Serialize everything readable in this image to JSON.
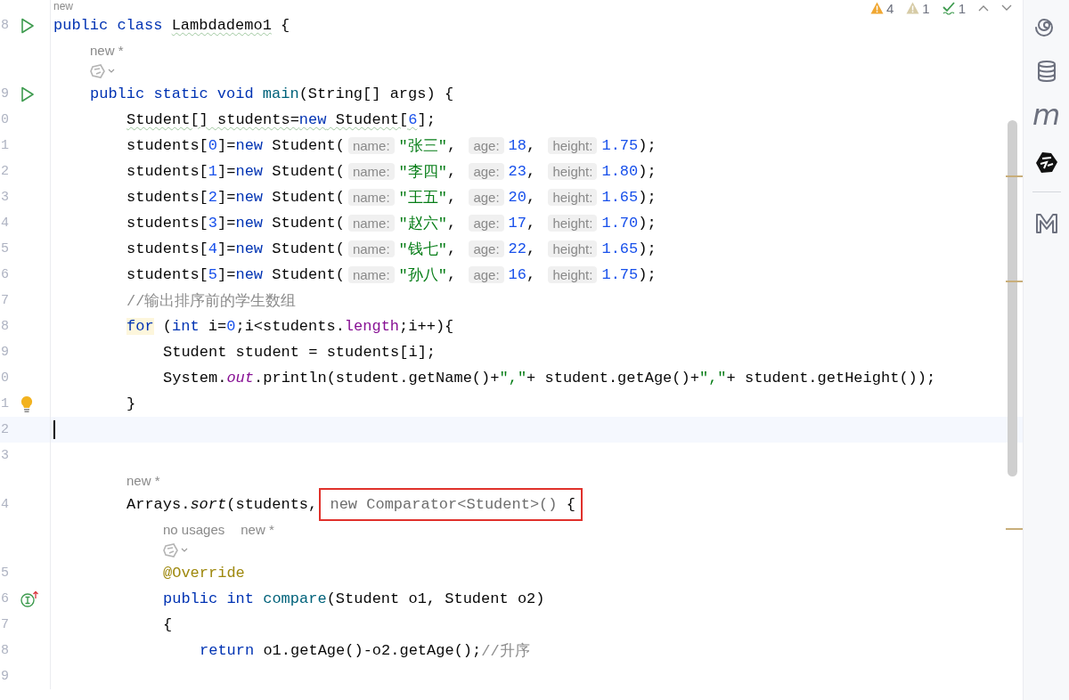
{
  "inspections": [
    {
      "kind": "warning",
      "count": "4"
    },
    {
      "kind": "weak_warning",
      "count": "1"
    },
    {
      "kind": "typo",
      "count": "1"
    }
  ],
  "lines": [
    {
      "kind": "lens",
      "texts": [
        "new"
      ]
    },
    {
      "kind": "code",
      "number": "8",
      "gutter_icon": {
        "kind": "run"
      },
      "tokens": [
        {
          "kind": "kw",
          "text": "public class "
        },
        {
          "kind": "plain",
          "text": "Lambdademo1",
          "typo": true
        },
        {
          "kind": "plain",
          "text": " {"
        }
      ],
      "children": [
        {
          "kind": "lens",
          "texts": [
            "new *"
          ]
        },
        {
          "kind": "ai"
        },
        {
          "kind": "code",
          "number": "9",
          "gutter_icon": {
            "kind": "run"
          },
          "tokens": [
            {
              "kind": "kw",
              "text": "public static void "
            },
            {
              "kind": "method",
              "text": "main"
            },
            {
              "kind": "plain",
              "text": "(String[] args) {"
            }
          ],
          "children": [
            {
              "kind": "code",
              "number": "0",
              "tokens": [
                {
                  "kind": "plain",
                  "text": "Student[] students=",
                  "typo": true
                },
                {
                  "kind": "kw",
                  "text": "new",
                  "typo": true
                },
                {
                  "kind": "plain",
                  "text": " Student[",
                  "typo": true
                },
                {
                  "kind": "num",
                  "text": "6",
                  "typo": true
                },
                {
                  "kind": "plain",
                  "text": "];"
                }
              ]
            },
            {
              "kind": "code",
              "number": "1",
              "tokens": [
                {
                  "kind": "plain",
                  "text": "students["
                },
                {
                  "kind": "num",
                  "text": "0"
                },
                {
                  "kind": "plain",
                  "text": "]="
                },
                {
                  "kind": "kw",
                  "text": "new"
                },
                {
                  "kind": "plain",
                  "text": " Student("
                },
                {
                  "kind": "hint",
                  "text": "name:"
                },
                {
                  "kind": "str",
                  "text": "\"张三\""
                },
                {
                  "kind": "plain",
                  "text": ", "
                },
                {
                  "kind": "hint",
                  "text": "age:"
                },
                {
                  "kind": "num",
                  "text": "18"
                },
                {
                  "kind": "plain",
                  "text": ", "
                },
                {
                  "kind": "hint",
                  "text": "height:"
                },
                {
                  "kind": "num",
                  "text": "1.75"
                },
                {
                  "kind": "plain",
                  "text": ");"
                }
              ]
            },
            {
              "kind": "code",
              "number": "2",
              "tokens": [
                {
                  "kind": "plain",
                  "text": "students["
                },
                {
                  "kind": "num",
                  "text": "1"
                },
                {
                  "kind": "plain",
                  "text": "]="
                },
                {
                  "kind": "kw",
                  "text": "new"
                },
                {
                  "kind": "plain",
                  "text": " Student("
                },
                {
                  "kind": "hint",
                  "text": "name:"
                },
                {
                  "kind": "str",
                  "text": "\"李四\""
                },
                {
                  "kind": "plain",
                  "text": ", "
                },
                {
                  "kind": "hint",
                  "text": "age:"
                },
                {
                  "kind": "num",
                  "text": "23"
                },
                {
                  "kind": "plain",
                  "text": ", "
                },
                {
                  "kind": "hint",
                  "text": "height:"
                },
                {
                  "kind": "num",
                  "text": "1.80"
                },
                {
                  "kind": "plain",
                  "text": ");"
                }
              ]
            },
            {
              "kind": "code",
              "number": "3",
              "tokens": [
                {
                  "kind": "plain",
                  "text": "students["
                },
                {
                  "kind": "num",
                  "text": "2"
                },
                {
                  "kind": "plain",
                  "text": "]="
                },
                {
                  "kind": "kw",
                  "text": "new"
                },
                {
                  "kind": "plain",
                  "text": " Student("
                },
                {
                  "kind": "hint",
                  "text": "name:"
                },
                {
                  "kind": "str",
                  "text": "\"王五\""
                },
                {
                  "kind": "plain",
                  "text": ", "
                },
                {
                  "kind": "hint",
                  "text": "age:"
                },
                {
                  "kind": "num",
                  "text": "20"
                },
                {
                  "kind": "plain",
                  "text": ", "
                },
                {
                  "kind": "hint",
                  "text": "height:"
                },
                {
                  "kind": "num",
                  "text": "1.65"
                },
                {
                  "kind": "plain",
                  "text": ");"
                }
              ]
            },
            {
              "kind": "code",
              "number": "4",
              "tokens": [
                {
                  "kind": "plain",
                  "text": "students["
                },
                {
                  "kind": "num",
                  "text": "3"
                },
                {
                  "kind": "plain",
                  "text": "]="
                },
                {
                  "kind": "kw",
                  "text": "new"
                },
                {
                  "kind": "plain",
                  "text": " Student("
                },
                {
                  "kind": "hint",
                  "text": "name:"
                },
                {
                  "kind": "str",
                  "text": "\"赵六\""
                },
                {
                  "kind": "plain",
                  "text": ", "
                },
                {
                  "kind": "hint",
                  "text": "age:"
                },
                {
                  "kind": "num",
                  "text": "17"
                },
                {
                  "kind": "plain",
                  "text": ", "
                },
                {
                  "kind": "hint",
                  "text": "height:"
                },
                {
                  "kind": "num",
                  "text": "1.70"
                },
                {
                  "kind": "plain",
                  "text": ");"
                }
              ]
            },
            {
              "kind": "code",
              "number": "5",
              "tokens": [
                {
                  "kind": "plain",
                  "text": "students["
                },
                {
                  "kind": "num",
                  "text": "4"
                },
                {
                  "kind": "plain",
                  "text": "]="
                },
                {
                  "kind": "kw",
                  "text": "new"
                },
                {
                  "kind": "plain",
                  "text": " Student("
                },
                {
                  "kind": "hint",
                  "text": "name:"
                },
                {
                  "kind": "str",
                  "text": "\"钱七\""
                },
                {
                  "kind": "plain",
                  "text": ", "
                },
                {
                  "kind": "hint",
                  "text": "age:"
                },
                {
                  "kind": "num",
                  "text": "22"
                },
                {
                  "kind": "plain",
                  "text": ", "
                },
                {
                  "kind": "hint",
                  "text": "height:"
                },
                {
                  "kind": "num",
                  "text": "1.65"
                },
                {
                  "kind": "plain",
                  "text": ");"
                }
              ]
            },
            {
              "kind": "code",
              "number": "6",
              "tokens": [
                {
                  "kind": "plain",
                  "text": "students["
                },
                {
                  "kind": "num",
                  "text": "5"
                },
                {
                  "kind": "plain",
                  "text": "]="
                },
                {
                  "kind": "kw",
                  "text": "new"
                },
                {
                  "kind": "plain",
                  "text": " Student("
                },
                {
                  "kind": "hint",
                  "text": "name:"
                },
                {
                  "kind": "str",
                  "text": "\"孙八\""
                },
                {
                  "kind": "plain",
                  "text": ", "
                },
                {
                  "kind": "hint",
                  "text": "age:"
                },
                {
                  "kind": "num",
                  "text": "16"
                },
                {
                  "kind": "plain",
                  "text": ", "
                },
                {
                  "kind": "hint",
                  "text": "height:"
                },
                {
                  "kind": "num",
                  "text": "1.75"
                },
                {
                  "kind": "plain",
                  "text": ");"
                }
              ]
            },
            {
              "kind": "code",
              "number": "7",
              "tokens": [
                {
                  "kind": "comment",
                  "text": "//输出排序前的学生数组"
                }
              ]
            },
            {
              "kind": "code",
              "number": "8",
              "tokens": [
                {
                  "kind": "kw",
                  "text": "for",
                  "highlighted": true
                },
                {
                  "kind": "plain",
                  "text": " ("
                },
                {
                  "kind": "kw",
                  "text": "int"
                },
                {
                  "kind": "plain",
                  "text": " i="
                },
                {
                  "kind": "num",
                  "text": "0"
                },
                {
                  "kind": "plain",
                  "text": ";i<students."
                },
                {
                  "kind": "field",
                  "text": "length"
                },
                {
                  "kind": "plain",
                  "text": ";i++){"
                }
              ],
              "children": [
                {
                  "kind": "code",
                  "number": "9",
                  "tokens": [
                    {
                      "kind": "plain",
                      "text": "Student student = students[i];"
                    }
                  ]
                },
                {
                  "kind": "code",
                  "number": "0",
                  "tokens": [
                    {
                      "kind": "plain",
                      "text": "System."
                    },
                    {
                      "kind": "static",
                      "text": "out"
                    },
                    {
                      "kind": "plain",
                      "text": ".println(student.getName()+"
                    },
                    {
                      "kind": "str",
                      "text": "\",\""
                    },
                    {
                      "kind": "plain",
                      "text": "+ student.getAge()+"
                    },
                    {
                      "kind": "str",
                      "text": "\",\""
                    },
                    {
                      "kind": "plain",
                      "text": "+ student.getHeight());"
                    }
                  ]
                }
              ]
            },
            {
              "kind": "code",
              "number": "1",
              "gutter_icon": {
                "kind": "bulb"
              },
              "tokens": [
                {
                  "kind": "plain",
                  "text": "}"
                }
              ]
            },
            {
              "kind": "code",
              "number": "2",
              "current": true
            },
            {
              "kind": "code",
              "number": "3"
            },
            {
              "kind": "lens",
              "texts": [
                "new *"
              ]
            },
            {
              "kind": "code",
              "number": "4",
              "tokens": [
                {
                  "kind": "plain",
                  "text": "Arrays."
                },
                {
                  "kind": "italic",
                  "text": "sort"
                },
                {
                  "kind": "plain",
                  "text": "(students, "
                },
                {
                  "kind": "folded",
                  "text": "new Comparator<Student>() ",
                  "boxed": true
                },
                {
                  "kind": "plain",
                  "text": "{",
                  "boxed": true
                }
              ],
              "children": [
                {
                  "kind": "lens",
                  "texts": [
                    "no usages",
                    "new *"
                  ]
                },
                {
                  "kind": "ai"
                },
                {
                  "kind": "code",
                  "number": "5",
                  "tokens": [
                    {
                      "kind": "annotation",
                      "text": "@Override"
                    }
                  ]
                },
                {
                  "kind": "code",
                  "number": "6",
                  "gutter_icon": {
                    "kind": "implements"
                  },
                  "tokens": [
                    {
                      "kind": "kw",
                      "text": "public int "
                    },
                    {
                      "kind": "method",
                      "text": "compare"
                    },
                    {
                      "kind": "plain",
                      "text": "(Student o1, Student o2)"
                    }
                  ]
                },
                {
                  "kind": "code",
                  "number": "7",
                  "tokens": [
                    {
                      "kind": "plain",
                      "text": "{"
                    }
                  ],
                  "children": [
                    {
                      "kind": "code",
                      "number": "8",
                      "tokens": [
                        {
                          "kind": "kw",
                          "text": "return"
                        },
                        {
                          "kind": "plain",
                          "text": " o1.getAge()-o2.getAge();"
                        },
                        {
                          "kind": "comment",
                          "text": "//升序"
                        }
                      ]
                    },
                    {
                      "kind": "code",
                      "number": "9"
                    }
                  ]
                }
              ]
            }
          ]
        }
      ]
    }
  ],
  "toolbar": [
    {
      "kind": "swirl"
    },
    {
      "kind": "database"
    },
    {
      "kind": "glyph",
      "glyph": "m"
    },
    {
      "kind": "ai"
    },
    {
      "kind": "divider"
    },
    {
      "kind": "markdown"
    }
  ]
}
